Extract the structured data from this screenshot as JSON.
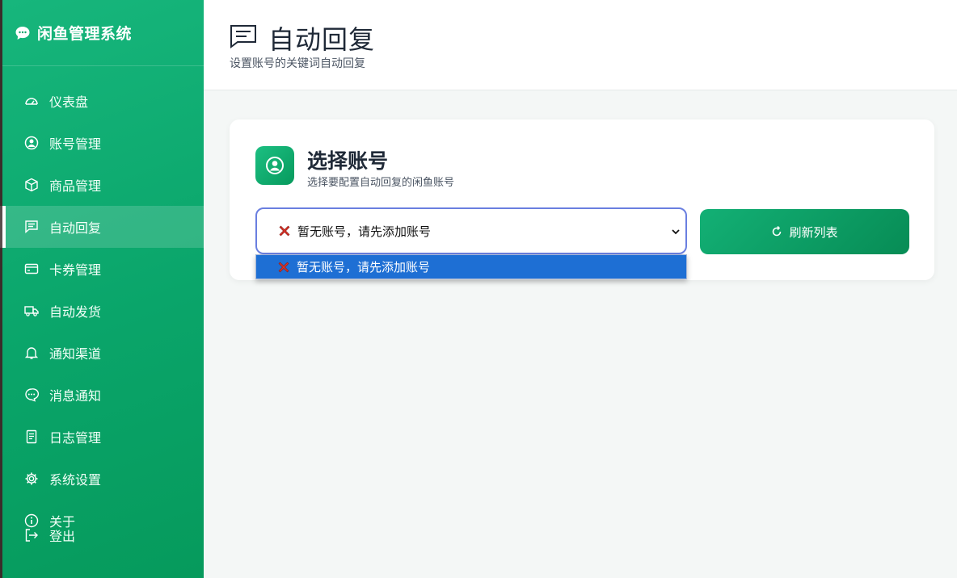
{
  "app": {
    "title": "闲鱼管理系统"
  },
  "sidebar": {
    "items": [
      {
        "label": "仪表盘",
        "icon": "dashboard-icon",
        "active": false
      },
      {
        "label": "账号管理",
        "icon": "user-circle-icon",
        "active": false
      },
      {
        "label": "商品管理",
        "icon": "box-icon",
        "active": false
      },
      {
        "label": "自动回复",
        "icon": "message-square-icon",
        "active": true
      },
      {
        "label": "卡券管理",
        "icon": "card-icon",
        "active": false
      },
      {
        "label": "自动发货",
        "icon": "truck-icon",
        "active": false
      },
      {
        "label": "通知渠道",
        "icon": "bell-icon",
        "active": false
      },
      {
        "label": "消息通知",
        "icon": "chat-dots-icon",
        "active": false
      },
      {
        "label": "日志管理",
        "icon": "document-icon",
        "active": false
      },
      {
        "label": "系统设置",
        "icon": "gear-icon",
        "active": false
      }
    ],
    "about_label": "关于",
    "logout_label": "登出"
  },
  "header": {
    "title": "自动回复",
    "subtitle": "设置账号的关键词自动回复"
  },
  "account_card": {
    "title": "选择账号",
    "subtitle": "选择要配置自动回复的闲鱼账号",
    "select_value": "暂无账号，请先添加账号",
    "refresh_label": "刷新列表",
    "dropdown_options": [
      "暂无账号，请先添加账号"
    ]
  },
  "colors": {
    "sidebar_green": "#0aa56a",
    "select_border": "#6a7fe0",
    "dropdown_highlight": "#1e6fd4"
  }
}
